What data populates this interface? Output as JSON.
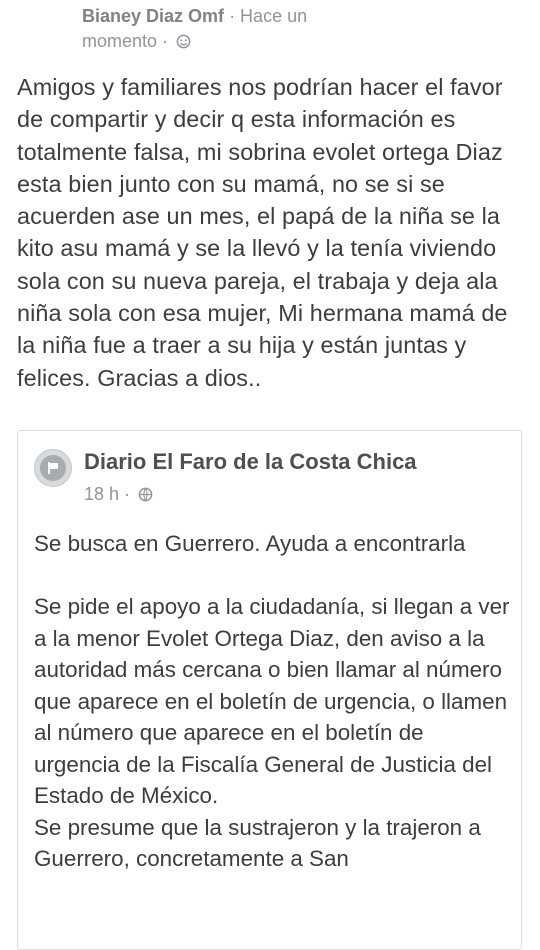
{
  "post": {
    "author": "Bianey Diaz Omf",
    "time_line1": "· Hace un",
    "time_line2": "momento ·",
    "privacy_icon": "friends-icon",
    "text": "Amigos y familiares nos podrían hacer el favor de compartir y decir q esta información es totalmente falsa, mi sobrina evolet ortega Diaz esta bien junto con su mamá, no se si se acuerden ase un mes, el papá de la niña se la kito asu mamá y se la llevó y la tenía viviendo sola con su nueva pareja, el trabaja y deja ala niña sola con esa mujer, Mi hermana mamá de la niña fue a traer a su hija y están juntas y felices. Gracias a dios.."
  },
  "shared": {
    "page_name": "Diario El Faro de la Costa Chica",
    "avatar_icon": "default-page-avatar-icon",
    "time": "18 h ·",
    "privacy_icon": "globe-icon",
    "paragraph1": "Se busca en Guerrero. Ayuda a encontrarla",
    "paragraph2": "Se pide el apoyo a la ciudadanía, si llegan  a  ver a la menor Evolet Ortega Diaz, den aviso a la autoridad más cercana o bien llamar al número que aparece  en el boletín de urgencia, o  llamen al número que aparece en el boletín de urgencia de la Fiscalía General de Justicia del Estado de México.",
    "paragraph3": "Se presume que la sustrajeron y la trajeron a Guerrero, concretamente a San"
  }
}
